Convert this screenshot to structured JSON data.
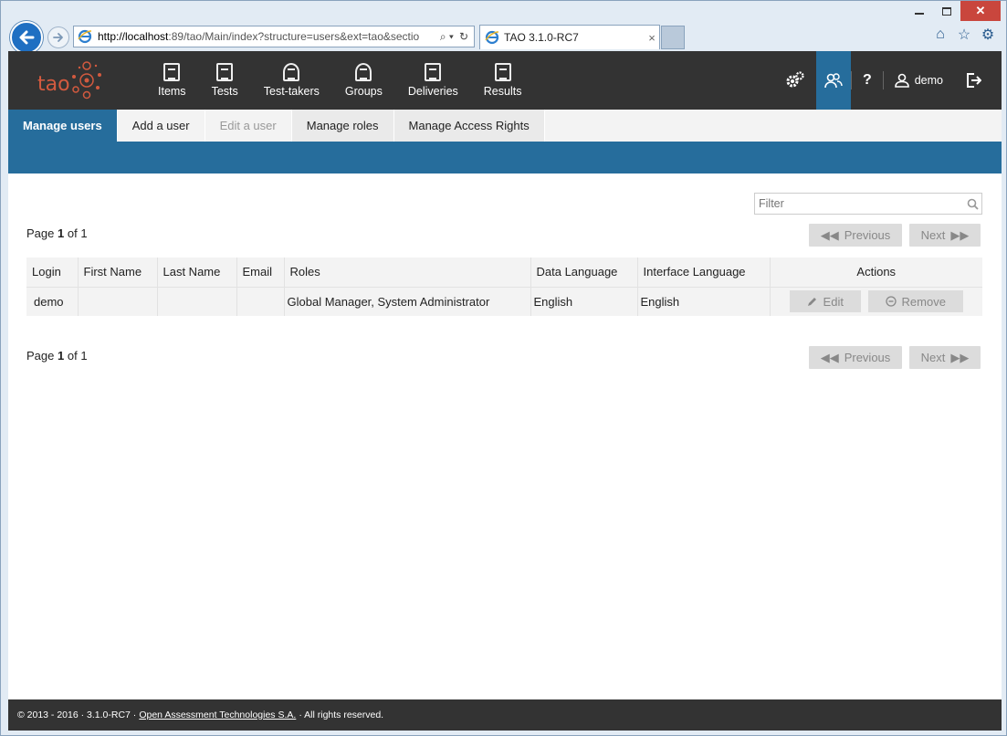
{
  "browser": {
    "url_host": "http://localhost",
    "url_rest": ":89/tao/Main/index?structure=users&ext=tao&sectio",
    "tab_title": "TAO 3.1.0-RC7",
    "tab_close": "×",
    "icons": [
      "home-icon",
      "favorites-star-icon",
      "settings-gear-icon"
    ]
  },
  "app": {
    "logo": "tao",
    "nav": [
      {
        "label": "Items"
      },
      {
        "label": "Tests"
      },
      {
        "label": "Test-takers"
      },
      {
        "label": "Groups"
      },
      {
        "label": "Deliveries"
      },
      {
        "label": "Results"
      }
    ],
    "help": "?",
    "user": "demo"
  },
  "subtabs": {
    "manage_users": "Manage users",
    "add_user": "Add a user",
    "edit_user": "Edit a user",
    "manage_roles": "Manage roles",
    "manage_access": "Manage Access Rights"
  },
  "filter": {
    "placeholder": "Filter"
  },
  "pager": {
    "page_label": "Page",
    "page_current": "1",
    "of_label": "of",
    "page_total": "1",
    "previous": "Previous",
    "next": "Next"
  },
  "table": {
    "headers": {
      "login": "Login",
      "first_name": "First Name",
      "last_name": "Last Name",
      "email": "Email",
      "roles": "Roles",
      "data_language": "Data Language",
      "interface_language": "Interface Language",
      "actions": "Actions"
    },
    "rows": [
      {
        "login": "demo",
        "first_name": "",
        "last_name": "",
        "email": "",
        "roles": "Global Manager, System Administrator",
        "data_language": "English",
        "interface_language": "English"
      }
    ],
    "edit": "Edit",
    "remove": "Remove"
  },
  "footer": {
    "copyright": "© 2013 - 2016 · 3.1.0-RC7 ·",
    "company": "Open Assessment Technologies S.A.",
    "rights": "· All rights reserved."
  },
  "colors": {
    "header_bg": "#333333",
    "accent_blue": "#266d9c",
    "logo_red": "#d35a3f"
  }
}
